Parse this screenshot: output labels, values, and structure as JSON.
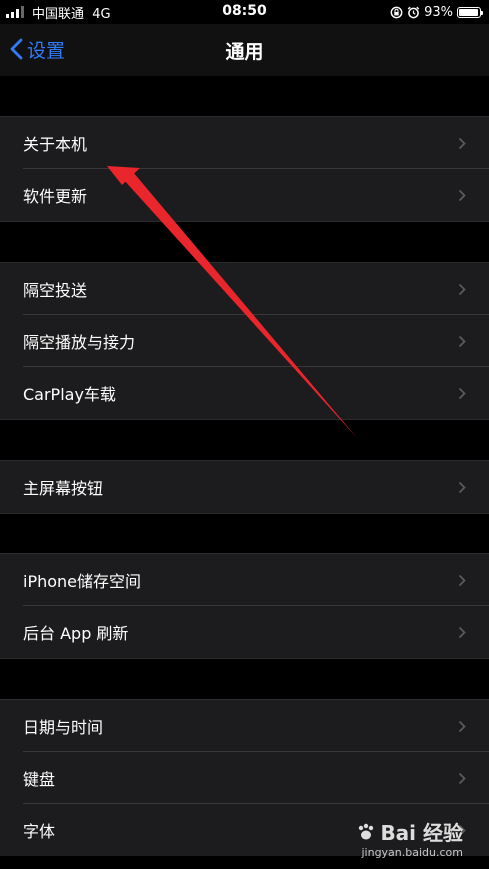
{
  "status_bar": {
    "carrier": "中国联通  4G",
    "time": "08:50",
    "battery_percent": "93%",
    "battery_level": 0.93,
    "icons": [
      "signal-bars-icon",
      "rotation-lock-icon",
      "alarm-icon",
      "battery-icon"
    ]
  },
  "nav": {
    "back_label": "设置",
    "title": "通用"
  },
  "sections": [
    {
      "items": [
        "关于本机",
        "软件更新"
      ]
    },
    {
      "items": [
        "隔空投送",
        "隔空播放与接力",
        "CarPlay车载"
      ]
    },
    {
      "items": [
        "主屏幕按钮"
      ]
    },
    {
      "items": [
        "iPhone储存空间",
        "后台 App 刷新"
      ]
    },
    {
      "items": [
        "日期与时间",
        "键盘",
        "字体"
      ]
    }
  ],
  "annotation": {
    "color": "#e8262c",
    "points_to": "关于本机"
  },
  "watermark": {
    "logo": "Bai 经验",
    "url": "jingyan.baidu.com"
  },
  "colors": {
    "background": "#000000",
    "cell": "#1c1c1e",
    "accent": "#2f7cf6"
  }
}
